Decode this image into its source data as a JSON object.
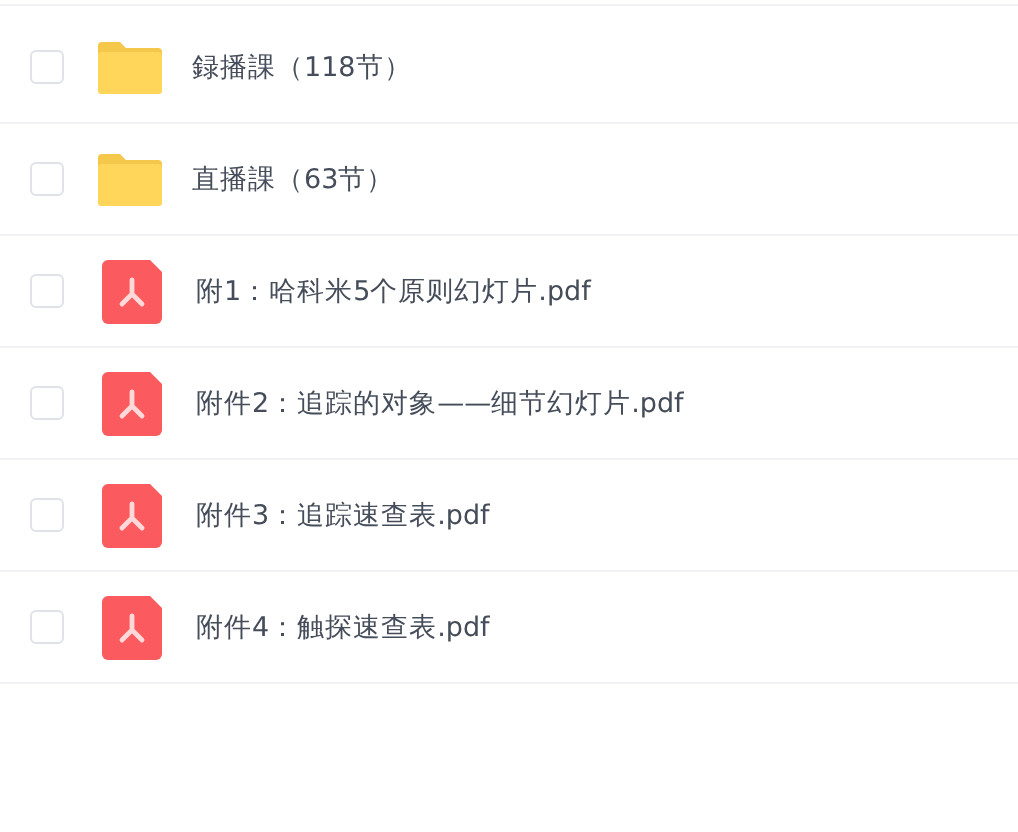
{
  "files": [
    {
      "kind": "folder",
      "name": "録播課（118节）",
      "checked": false
    },
    {
      "kind": "folder",
      "name": "直播課（63节）",
      "checked": false
    },
    {
      "kind": "pdf",
      "name": "附1：哈科米5个原则幻灯片.pdf",
      "checked": false
    },
    {
      "kind": "pdf",
      "name": "附件2：追踪的对象——细节幻灯片.pdf",
      "checked": false
    },
    {
      "kind": "pdf",
      "name": "附件3：追踪速查表.pdf",
      "checked": false
    },
    {
      "kind": "pdf",
      "name": "附件4：触探速查表.pdf",
      "checked": false
    }
  ]
}
